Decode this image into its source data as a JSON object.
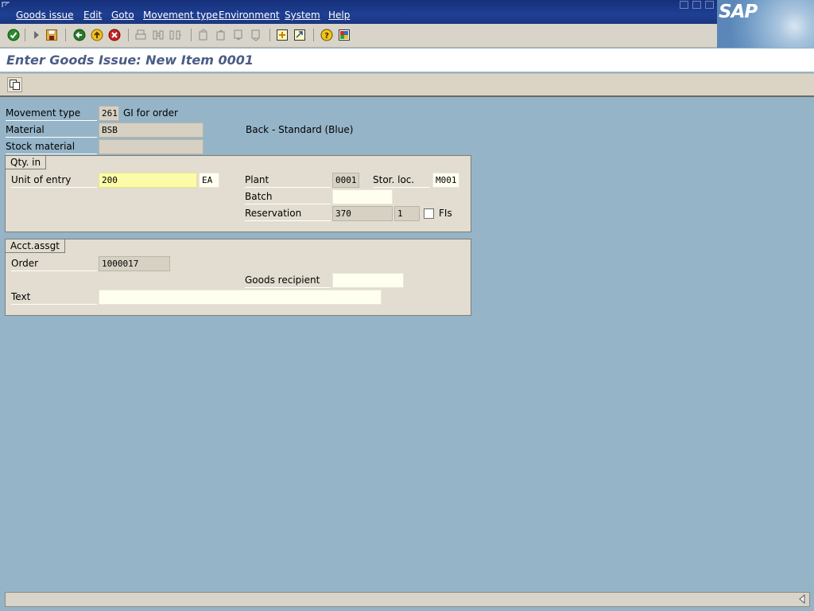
{
  "menubar": {
    "items": [
      "Goods issue",
      "Edit",
      "Goto",
      "Movement type",
      "Environment",
      "System",
      "Help"
    ],
    "logo": "SAP"
  },
  "toolbar": {
    "icons": [
      "enter-icon",
      "command-field-icon",
      "save-icon",
      "back-icon",
      "exit-icon",
      "cancel-icon",
      "print-icon",
      "find-icon",
      "find-next-icon",
      "first-page-icon",
      "previous-page-icon",
      "next-page-icon",
      "last-page-icon",
      "create-session-icon",
      "shortcut-icon",
      "help-icon",
      "layout-menu-icon"
    ]
  },
  "title": "Enter Goods Issue: New Item 0001",
  "header": {
    "movement_type_label": "Movement type",
    "movement_type_value": "261",
    "movement_type_text": "GI for order",
    "material_label": "Material",
    "material_value": "BSB",
    "material_desc": "Back - Standard (Blue)",
    "stock_material_label": "Stock material",
    "stock_material_value": ""
  },
  "qty_group": {
    "title": "Qty. in",
    "unit_of_entry_label": "Unit of entry",
    "quantity": "200",
    "unit": "EA",
    "plant_label": "Plant",
    "plant_value": "0001",
    "stor_loc_label": "Stor. loc.",
    "stor_loc_value": "M001",
    "batch_label": "Batch",
    "batch_value": "",
    "reservation_label": "Reservation",
    "reservation_value": "370",
    "reservation_item": "1",
    "fis_label": "FIs"
  },
  "acct_group": {
    "title": "Acct.assgt",
    "order_label": "Order",
    "order_value": "1000017",
    "goods_recipient_label": "Goods recipient",
    "goods_recipient_value": "",
    "text_label": "Text",
    "text_value": ""
  },
  "colors": {
    "menubar": "#1e3f93",
    "background": "#95b4c8",
    "title_text": "#4b5c86",
    "required_field": "#fbfba8"
  }
}
